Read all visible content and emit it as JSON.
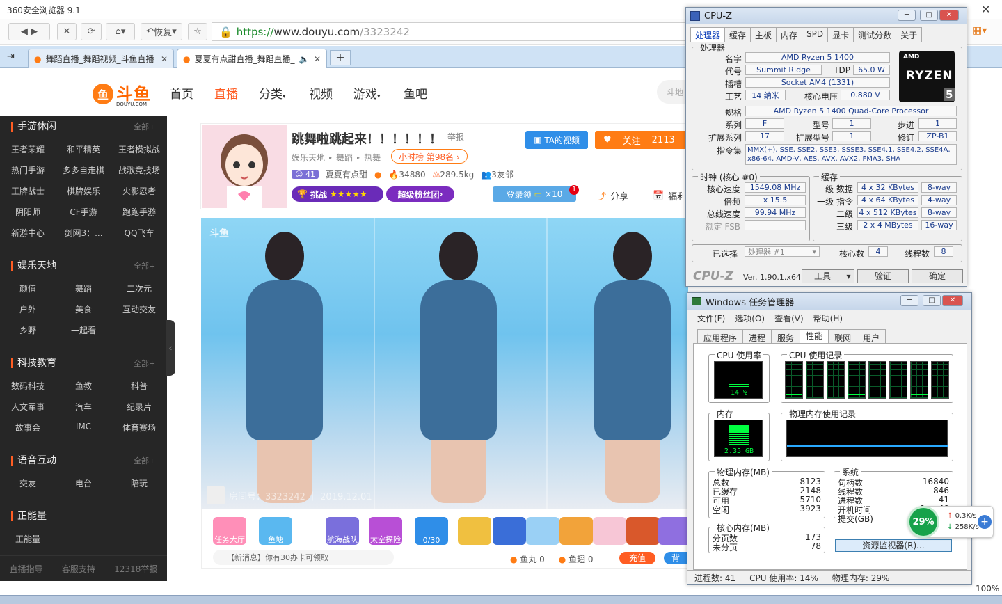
{
  "browser": {
    "title": "360安全浏览器 9.1",
    "restore_label": "恢复",
    "url_scheme": "https://",
    "url_host": "www.douyu.com",
    "url_path": "/3323242",
    "tabs": [
      {
        "label": "舞蹈直播_舞蹈视频_斗鱼直播"
      },
      {
        "label": "夏夏有点甜直播_舞蹈直播_"
      }
    ],
    "zoom": "100%"
  },
  "douyu": {
    "logo": "斗鱼",
    "logo_en": "DOUYU.COM",
    "nav": [
      "首页",
      "直播",
      "分类",
      "视频",
      "游戏",
      "鱼吧"
    ],
    "search_placeholder": "斗地"
  },
  "sidebar": {
    "sections": [
      {
        "title": "手游休闲",
        "more": "全部+",
        "items": [
          "王者荣耀",
          "和平精英",
          "王者模拟战",
          "热门手游",
          "多多自走棋",
          "战歌竞技场",
          "王牌战士",
          "棋牌娱乐",
          "火影忍者",
          "阴阳师",
          "CF手游",
          "跑跑手游",
          "新游中心",
          "剑网3：...",
          "QQ飞车"
        ]
      },
      {
        "title": "娱乐天地",
        "more": "全部+",
        "items": [
          "颜值",
          "舞蹈",
          "二次元",
          "户外",
          "美食",
          "互动交友",
          "乡野",
          "一起看"
        ]
      },
      {
        "title": "科技教育",
        "more": "全部+",
        "items": [
          "数码科技",
          "鱼教",
          "科普",
          "人文军事",
          "汽车",
          "纪录片",
          "故事会",
          "IMC",
          "体育赛场"
        ]
      },
      {
        "title": "语音互动",
        "more": "全部+",
        "items": [
          "交友",
          "电台",
          "陪玩"
        ]
      },
      {
        "title": "正能量",
        "more": "",
        "items": [
          "正能量"
        ]
      }
    ],
    "footer": [
      "直播指导",
      "客服支持",
      "12318举报"
    ]
  },
  "room": {
    "title": "跳舞啦跳起来！！！！！！",
    "report": "举报",
    "crumb": [
      "娱乐天地",
      "舞蹈",
      "热舞"
    ],
    "rank": "小时榜 第98名",
    "level": "41",
    "streamer": "夏夏有点甜",
    "hot": "34880",
    "weight": "289.5kg",
    "neighbors": "3友邻",
    "ta_video": "TA的视频",
    "follow": "关注",
    "follow_count": "2113",
    "challenge": "挑战",
    "fanclub": "超级粉丝团",
    "login_get": "登录领",
    "login_x": "×10",
    "login_badge": "1",
    "share": "分享",
    "welfare": "福利",
    "room_number": "房间号：3323242 ｜ 2019.12.01"
  },
  "gifts": {
    "items": [
      "任务大厅",
      "鱼塘",
      "航海战队",
      "太空探险",
      "0/30"
    ],
    "ticker": "【新消息】你有30办卡可领取",
    "fish_ball": "鱼丸 0",
    "fish_wing": "鱼翅 0",
    "charge": "充值",
    "backpack": "背"
  },
  "cpuz": {
    "title": "CPU-Z",
    "tabs": [
      "处理器",
      "缓存",
      "主板",
      "内存",
      "SPD",
      "显卡",
      "测试分数",
      "关于"
    ],
    "group_processor": "处理器",
    "name_lbl": "名字",
    "name": "AMD Ryzen 5 1400",
    "code_lbl": "代号",
    "code": "Summit Ridge",
    "tdp_lbl": "TDP",
    "tdp": "65.0 W",
    "socket_lbl": "插槽",
    "socket": "Socket AM4 (1331)",
    "process_lbl": "工艺",
    "process": "14 纳米",
    "vcore_lbl": "核心电压",
    "vcore": "0.880 V",
    "spec_lbl": "规格",
    "spec": "AMD Ryzen 5 1400 Quad-Core Processor",
    "family_lbl": "系列",
    "family": "F",
    "model_lbl": "型号",
    "model": "1",
    "stepping_lbl": "步进",
    "stepping": "1",
    "extfam_lbl": "扩展系列",
    "extfam": "17",
    "extmodel_lbl": "扩展型号",
    "extmodel": "1",
    "rev_lbl": "修订",
    "rev": "ZP-B1",
    "instr_lbl": "指令集",
    "instr": "MMX(+), SSE, SSE2, SSE3, SSSE3, SSE4.1, SSE4.2, SSE4A, x86-64, AMD-V, AES, AVX, AVX2, FMA3, SHA",
    "group_clock": "时钟 (核心 #0)",
    "corespeed_lbl": "核心速度",
    "corespeed": "1549.08 MHz",
    "mult_lbl": "倍频",
    "mult": "x 15.5",
    "bus_lbl": "总线速度",
    "bus": "99.94 MHz",
    "fsb_lbl": "额定 FSB",
    "group_cache": "缓存",
    "l1d_lbl": "一级 数据",
    "l1d": "4 x 32 KBytes",
    "l1d_w": "8-way",
    "l1i_lbl": "一级 指令",
    "l1i": "4 x 64 KBytes",
    "l1i_w": "4-way",
    "l2_lbl": "二级",
    "l2": "4 x 512 KBytes",
    "l2_w": "8-way",
    "l3_lbl": "三级",
    "l3": "2 x 4 MBytes",
    "l3_w": "16-way",
    "sel_lbl": "已选择",
    "sel": "处理器 #1",
    "cores_lbl": "核心数",
    "cores": "4",
    "threads_lbl": "线程数",
    "threads": "8",
    "brand": "CPU-Z",
    "version": "Ver. 1.90.1.x64",
    "tools": "工具",
    "validate": "验证",
    "ok": "确定",
    "ryzen_text": "RYZEN",
    "ryzen_num": "5",
    "amd": "AMD"
  },
  "taskmgr": {
    "title": "Windows 任务管理器",
    "menu": [
      "文件(F)",
      "选项(O)",
      "查看(V)",
      "帮助(H)"
    ],
    "tabs": [
      "应用程序",
      "进程",
      "服务",
      "性能",
      "联网",
      "用户"
    ],
    "cpu_usage_lbl": "CPU 使用率",
    "cpu_usage": "14 %",
    "cpu_hist_lbl": "CPU 使用记录",
    "mem_lbl": "内存",
    "mem": "2.35 GB",
    "mem_hist_lbl": "物理内存使用记录",
    "phys_lbl": "物理内存(MB)",
    "phys": [
      [
        "总数",
        "8123"
      ],
      [
        "已缓存",
        "2148"
      ],
      [
        "可用",
        "5710"
      ],
      [
        "空闲",
        "3923"
      ]
    ],
    "sys_lbl": "系统",
    "sys": [
      [
        "句柄数",
        "16840"
      ],
      [
        "线程数",
        "846"
      ],
      [
        "进程数",
        "41"
      ],
      [
        "开机时间",
        "0:...:40"
      ],
      [
        "提交(GB)",
        ""
      ]
    ],
    "kernel_lbl": "核心内存(MB)",
    "kernel": [
      [
        "分页数",
        "173"
      ],
      [
        "未分页",
        "78"
      ]
    ],
    "resmon": "资源监视器(R)...",
    "status": [
      "进程数: 41",
      "CPU 使用率: 14%",
      "物理内存: 29%"
    ],
    "cpu_percent": 14,
    "cores_hist_count": 8
  },
  "netwidget": {
    "pct": "29%",
    "up": "0.3K/s",
    "down": "258K/s"
  },
  "colors": {
    "douyu_orange": "#ff5d23",
    "cpuz_blue": "#1a3b8c",
    "lcd_green": "#00ff40"
  }
}
